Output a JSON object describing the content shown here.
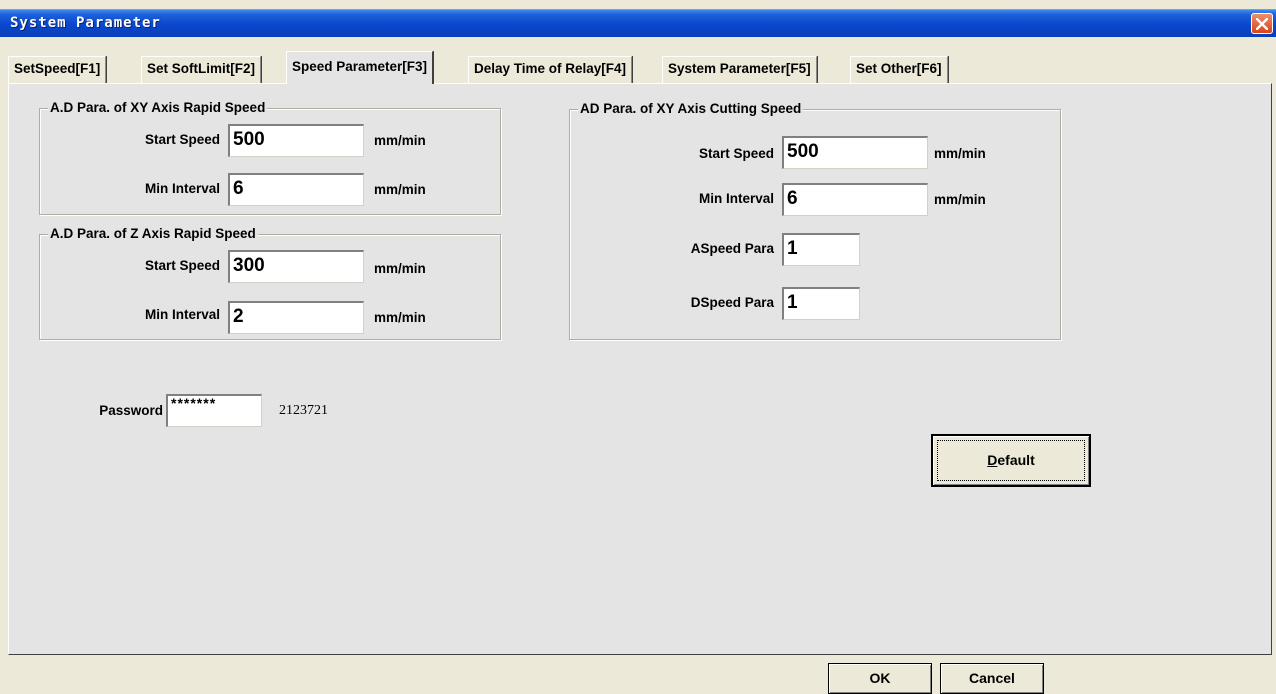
{
  "window": {
    "title": "System Parameter"
  },
  "tabs": [
    {
      "label": "SetSpeed[F1]"
    },
    {
      "label": "Set SoftLimit[F2]"
    },
    {
      "label": "Speed Parameter[F3]"
    },
    {
      "label": "Delay Time of Relay[F4]"
    },
    {
      "label": "System Parameter[F5]"
    },
    {
      "label": "Set Other[F6]"
    }
  ],
  "active_tab": "Speed Parameter[F3]",
  "xy_rapid": {
    "title": "A.D Para. of XY Axis Rapid Speed",
    "start_label": "Start Speed",
    "start_value": "500",
    "start_unit": "mm/min",
    "interval_label": "Min Interval",
    "interval_value": "6",
    "interval_unit": "mm/min"
  },
  "z_rapid": {
    "title": "A.D Para. of Z Axis Rapid Speed",
    "start_label": "Start Speed",
    "start_value": "300",
    "start_unit": "mm/min",
    "interval_label": "Min Interval",
    "interval_value": "2",
    "interval_unit": "mm/min"
  },
  "xy_cutting": {
    "title": "AD Para. of XY Axis Cutting Speed",
    "start_label": "Start Speed",
    "start_value": "500",
    "start_unit": "mm/min",
    "interval_label": "Min Interval",
    "interval_value": "6",
    "interval_unit": "mm/min",
    "aspeed_label": "ASpeed Para",
    "aspeed_value": "1",
    "dspeed_label": "DSpeed Para",
    "dspeed_value": "1"
  },
  "password": {
    "label": "Password",
    "value": "*******",
    "code": "2123721"
  },
  "buttons": {
    "default_label_accel": "D",
    "default_label_rest": "efault",
    "ok": "OK",
    "cancel": "Cancel"
  },
  "colors": {
    "title_bar": "#0a46cc",
    "close_button": "#d9431a",
    "dialog_bg": "#ece9d8",
    "page_bg": "#e4e4e4"
  }
}
